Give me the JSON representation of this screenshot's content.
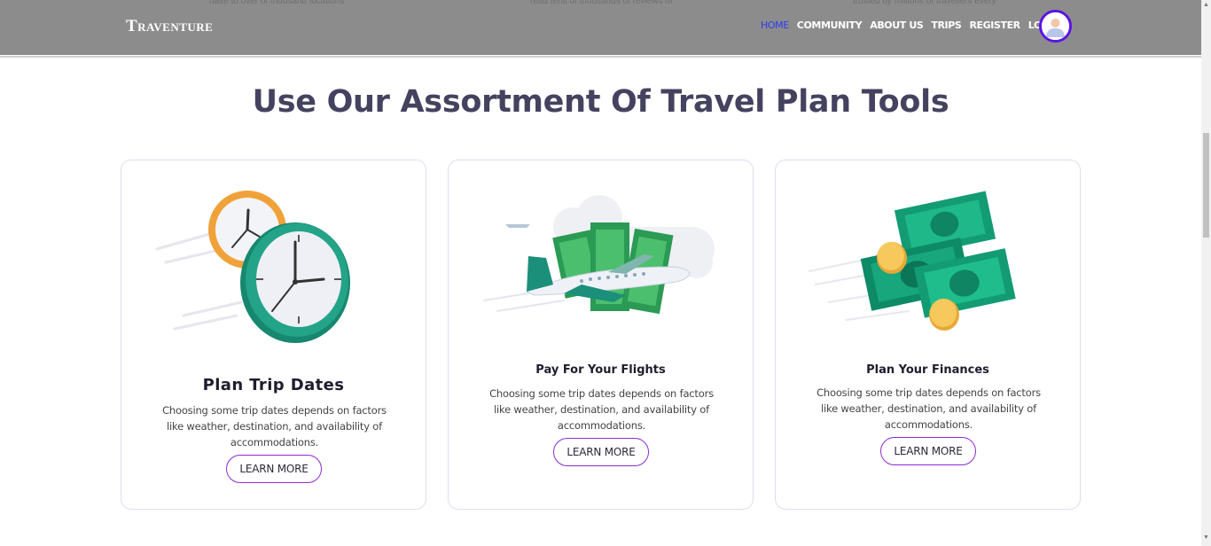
{
  "header": {
    "brand": "Traventure",
    "ghost_texts": [
      "have to over of thousand locations",
      "read tens of thousands of reviews of",
      "trusted by millions of travellers every"
    ],
    "nav": [
      "HOME",
      "COMMUNITY",
      "ABOUT US",
      "TRIPS",
      "REGISTER",
      "LOGIN"
    ],
    "active_nav": "HOME",
    "colors": {
      "bar": "#8c8c8c",
      "active": "#2b3cf5",
      "avatar_ring": "#5a13e6"
    }
  },
  "section": {
    "title": "Use Our Assortment Of Travel Plan Tools",
    "cards": [
      {
        "title": "Plan Trip Dates",
        "description": "Choosing some trip dates depends on factors like weather, destination, and availability of accommodations.",
        "button": "LEARN MORE",
        "icon": "clock-icon"
      },
      {
        "title": "Pay For Your Flights",
        "description": "Choosing some trip dates depends on factors like weather, destination, and availability of accommodations.",
        "button": "LEARN MORE",
        "icon": "airplane-money-icon"
      },
      {
        "title": "Plan Your Finances",
        "description": "Choosing some trip dates depends on factors like weather, destination, and availability of accommodations.",
        "button": "LEARN MORE",
        "icon": "money-coins-icon"
      }
    ],
    "colors": {
      "title": "#45425f",
      "button_border": "#8a2bd6",
      "card_border": "#e0dcef"
    }
  }
}
